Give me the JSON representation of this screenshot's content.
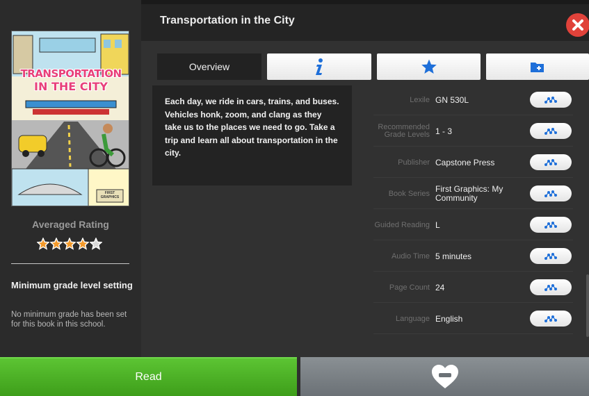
{
  "header": {
    "title": "Transportation in the City"
  },
  "cover": {
    "title_line1": "TRANSPORTATION",
    "title_line2": "IN THE CITY",
    "small_box_text": "FIRST GRAPHICS"
  },
  "rating": {
    "label": "Averaged Rating",
    "value": 4,
    "max": 5
  },
  "min_grade": {
    "title": "Minimum grade level setting",
    "text": "No minimum grade has been set for this book in this school."
  },
  "tabs": {
    "overview_label": "Overview"
  },
  "overview": {
    "text": "Each day, we ride in cars, trains, and buses. Vehicles honk, zoom, and clang as they take us to the places we need to go. Take a trip and learn all about transportation in the city."
  },
  "info": [
    {
      "label": "Lexile",
      "value": "GN 530L"
    },
    {
      "label": "Recommended Grade Levels",
      "value": "1 - 3"
    },
    {
      "label": "Publisher",
      "value": "Capstone Press"
    },
    {
      "label": "Book Series",
      "value": "First Graphics: My Community"
    },
    {
      "label": "Guided Reading",
      "value": "L"
    },
    {
      "label": "Audio Time",
      "value": "5 minutes"
    },
    {
      "label": "Page Count",
      "value": "24"
    },
    {
      "label": "Language",
      "value": "English"
    }
  ],
  "buttons": {
    "read_label": "Read"
  },
  "colors": {
    "accent_blue": "#1e6fd9",
    "close_red": "#e0423a",
    "read_green": "#4caf26",
    "star_orange": "#f39a2b"
  },
  "icons": {
    "close": "close-icon",
    "info": "info-icon",
    "favorite": "star-icon",
    "folder": "folder-plus-icon",
    "search_similar": "similar-icon",
    "unfavorite": "heart-minus-icon"
  }
}
